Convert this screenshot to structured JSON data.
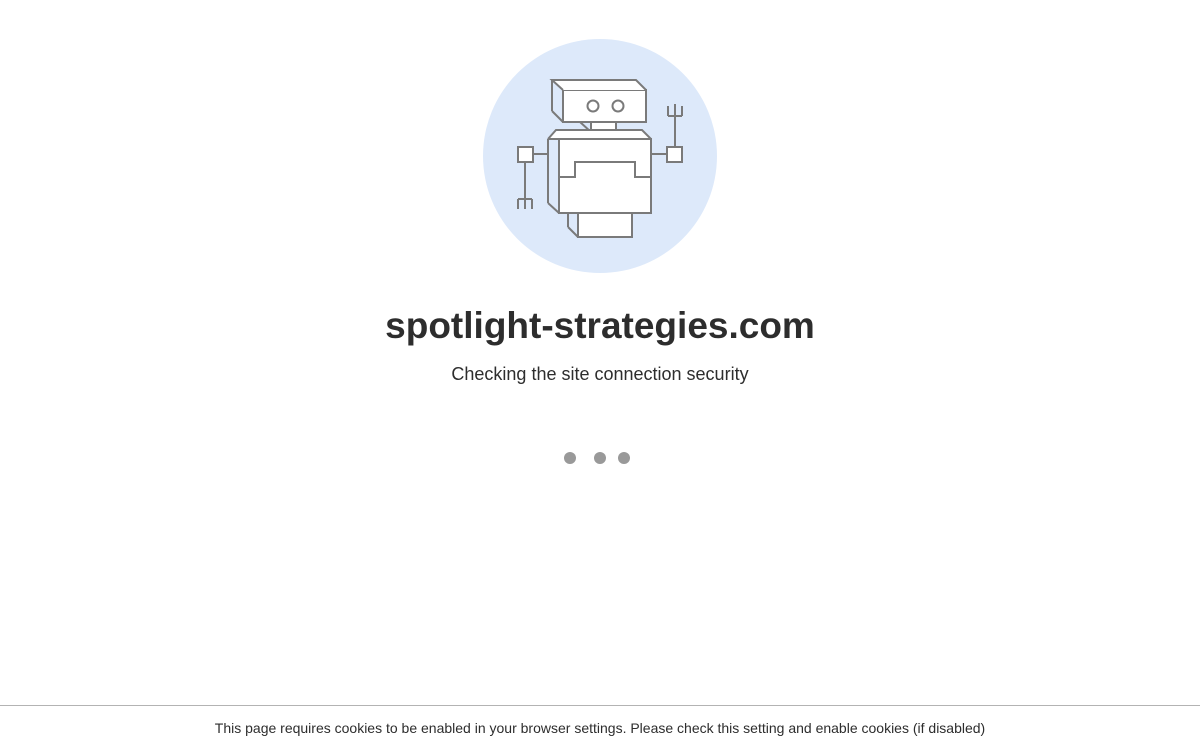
{
  "site": {
    "domain": "spotlight-strategies.com",
    "status_text": "Checking the site connection security"
  },
  "illustration": {
    "icon": "robot-icon",
    "circle_color": "#dde9fa",
    "stroke_color": "#7a7a7a"
  },
  "loader": {
    "dot_count": 3,
    "dot_color": "#999999"
  },
  "footer": {
    "notice": "This page requires cookies to be enabled in your browser settings. Please check this setting and enable cookies (if disabled)"
  }
}
